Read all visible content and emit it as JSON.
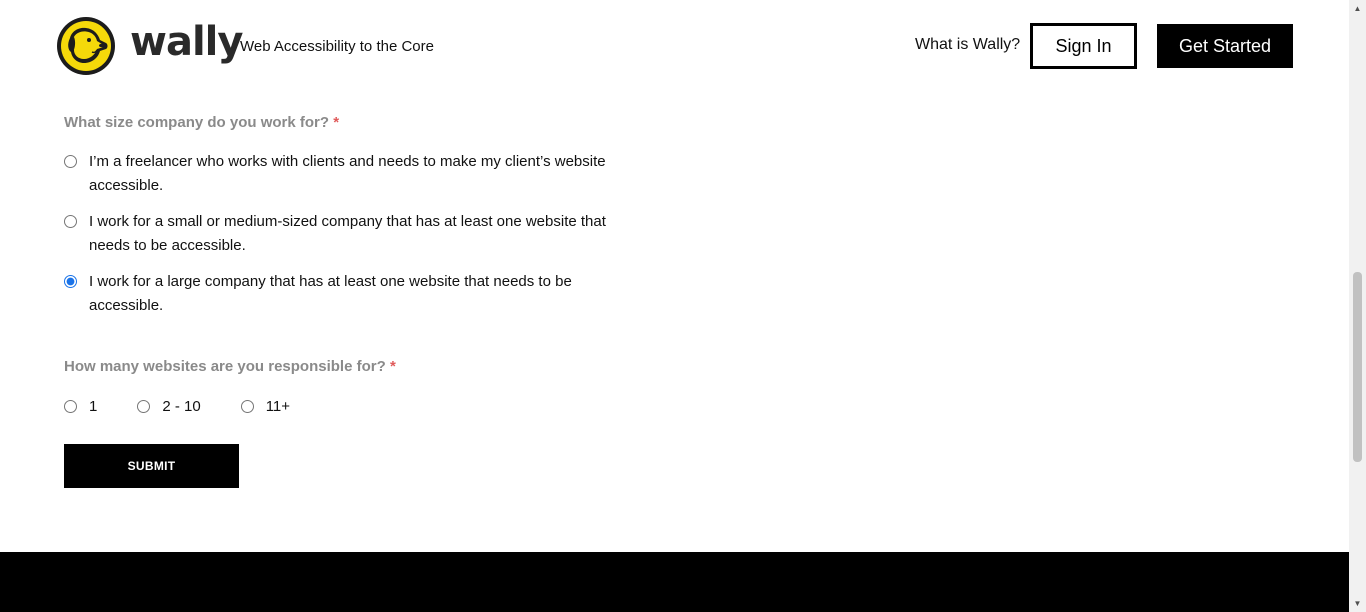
{
  "header": {
    "logo_text": "wally",
    "tagline": "Web Accessibility to the Core",
    "nav_link": "What is Wally?",
    "sign_in": "Sign In",
    "get_started": "Get Started"
  },
  "form": {
    "q1": {
      "label": "What size company do you work for?",
      "required_mark": "*",
      "options": [
        {
          "text": "I’m a freelancer who works with clients and needs to make my client’s website accessible.",
          "checked": false
        },
        {
          "text": "I work for a small or medium-sized company that has at least one website that needs to be accessible.",
          "checked": false
        },
        {
          "text": "I work for a large company that has at least one website that needs to be accessible.",
          "checked": true
        }
      ]
    },
    "q2": {
      "label": "How many websites are you responsible for?",
      "required_mark": "*",
      "options": [
        {
          "text": "1",
          "checked": false
        },
        {
          "text": "2 - 10",
          "checked": false
        },
        {
          "text": "11+",
          "checked": false
        }
      ]
    },
    "submit": "SUBMIT"
  },
  "colors": {
    "logo_badge": "#f5d90a",
    "required": "#e05a5a",
    "question_label": "#8a8a8a",
    "radio_accent": "#1a73e8"
  },
  "icons": {
    "logo": "dog-head-icon",
    "scroll_up": "scroll-up-arrow-icon",
    "scroll_down": "scroll-down-arrow-icon"
  }
}
